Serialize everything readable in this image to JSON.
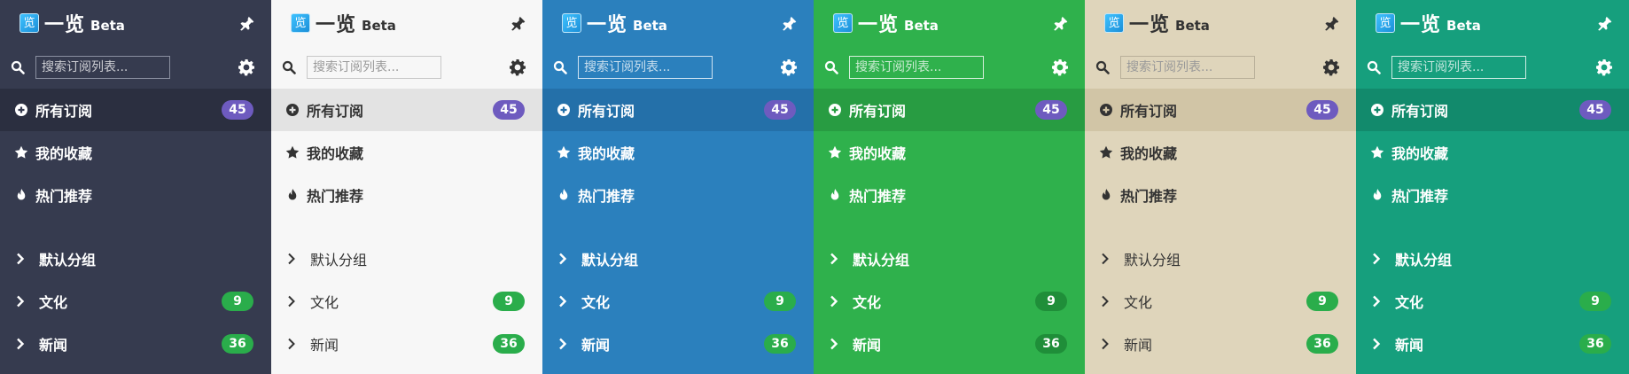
{
  "themes": [
    {
      "id": "dark",
      "background": "#363b4f",
      "text": "#ffffff"
    },
    {
      "id": "light",
      "background": "#f7f7f7",
      "text": "#333333"
    },
    {
      "id": "blue",
      "background": "#2b80bd",
      "text": "#ffffff"
    },
    {
      "id": "green",
      "background": "#2fb14c",
      "text": "#ffffff"
    },
    {
      "id": "beige",
      "background": "#dfd5bb",
      "text": "#333333"
    },
    {
      "id": "teal",
      "background": "#169f7d",
      "text": "#ffffff"
    }
  ],
  "header": {
    "logo_glyph": "览",
    "app_name": "一览",
    "beta_label": "Beta",
    "pin_icon": "pin-icon"
  },
  "search": {
    "placeholder": "搜索订阅列表...",
    "value": "",
    "search_icon": "search-icon",
    "settings_icon": "gear-icon"
  },
  "nav": {
    "all": {
      "label": "所有订阅",
      "count": "45",
      "icon": "plus-circle-icon",
      "badge_color": "#6e5bbf"
    },
    "favorites": {
      "label": "我的收藏",
      "icon": "star-icon"
    },
    "hot": {
      "label": "热门推荐",
      "icon": "fire-icon"
    }
  },
  "groups": [
    {
      "label": "默认分组",
      "count": ""
    },
    {
      "label": "文化",
      "count": "9"
    },
    {
      "label": "新闻",
      "count": "36"
    }
  ],
  "group_badge_color": "#2aad4b"
}
